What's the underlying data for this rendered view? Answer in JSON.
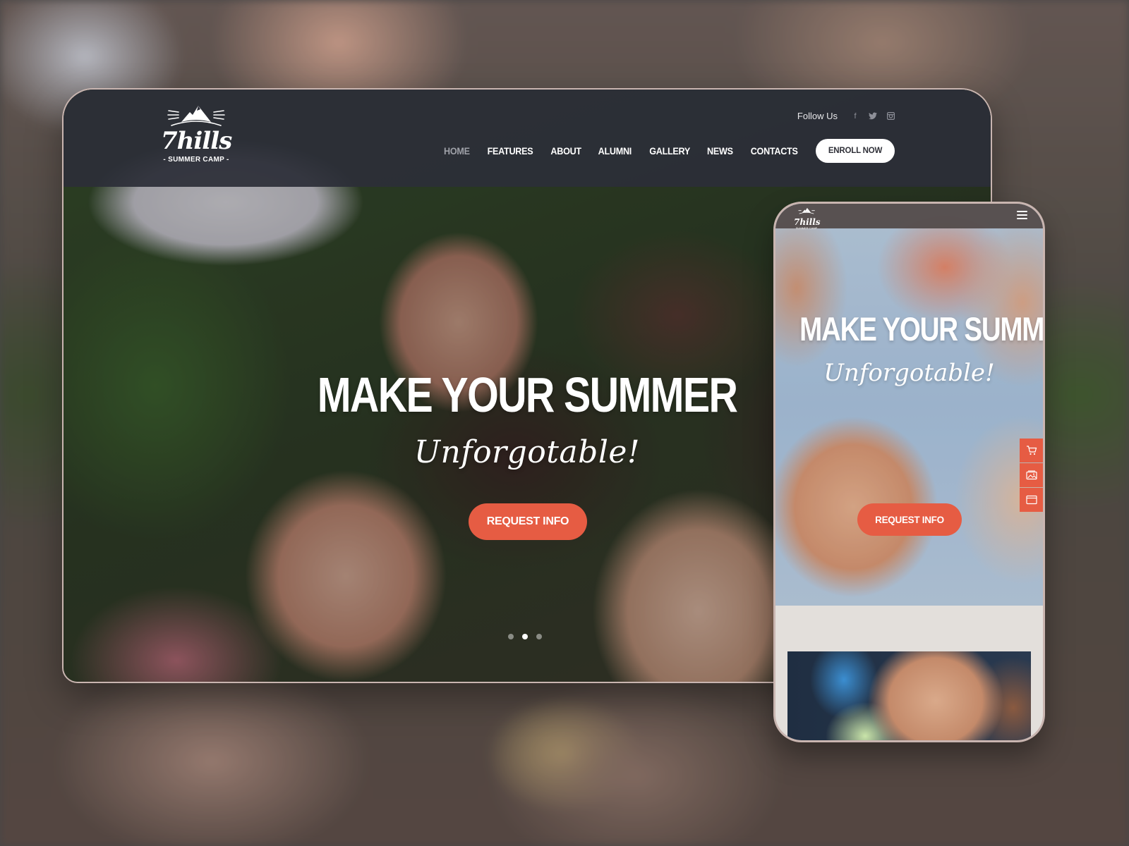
{
  "desktop": {
    "logo": {
      "word": "7hills",
      "subtitle": "- SUMMER CAMP -",
      "icon": "mountain-icon"
    },
    "follow": {
      "label": "Follow Us",
      "icons": [
        {
          "name": "facebook-icon",
          "glyph": "f"
        },
        {
          "name": "twitter-icon",
          "glyph": "t"
        },
        {
          "name": "instagram-icon",
          "glyph": "◘"
        }
      ]
    },
    "nav": {
      "items": [
        {
          "label": "HOME",
          "active": true
        },
        {
          "label": "FEATURES",
          "active": false
        },
        {
          "label": "ABOUT",
          "active": false
        },
        {
          "label": "ALUMNI",
          "active": false
        },
        {
          "label": "GALLERY",
          "active": false
        },
        {
          "label": "NEWS",
          "active": false
        },
        {
          "label": "CONTACTS",
          "active": false
        }
      ],
      "cta": "ENROLL NOW"
    },
    "hero": {
      "title": "MAKE YOUR SUMMER",
      "script": "Unforgotable!",
      "button": "REQUEST INFO",
      "slides": {
        "count": 3,
        "active": 2
      }
    }
  },
  "mobile": {
    "logo": {
      "word": "7hills",
      "subtitle": "SUMMER CAMP"
    },
    "menu_icon": "hamburger-icon",
    "hero": {
      "title": "MAKE YOUR SUMMER",
      "script": "Unforgotable!",
      "button": "REQUEST INFO"
    },
    "side_icons": [
      "cart-icon",
      "gallery-icon",
      "browser-window-icon"
    ]
  },
  "colors": {
    "accent": "#e65c43",
    "header_dark": "#2c2e38",
    "button_light": "#ffffff"
  }
}
